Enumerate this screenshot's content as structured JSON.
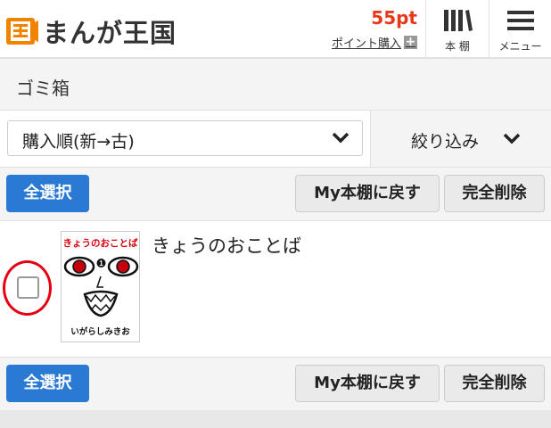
{
  "header": {
    "logo_text": "まんが王国",
    "points": "55pt",
    "buy_points": "ポイント購入",
    "plus": "+",
    "shelf_label": "本 棚",
    "menu_label": "メニュー"
  },
  "page": {
    "title": "ゴミ箱"
  },
  "sort": {
    "selected": "購入順(新→古)",
    "filter_label": "絞り込み"
  },
  "actions": {
    "select_all": "全選択",
    "restore": "My本棚に戻す",
    "delete_all": "完全削除"
  },
  "books": [
    {
      "title": "きょうのおことば",
      "cover_title": "きょうのおことば",
      "cover_author": "いがらしみきお",
      "checked": false
    }
  ],
  "colors": {
    "accent_blue": "#2a79d3",
    "points_red": "#e8381b",
    "logo_orange": "#f08300",
    "highlight_red": "#e60012"
  }
}
